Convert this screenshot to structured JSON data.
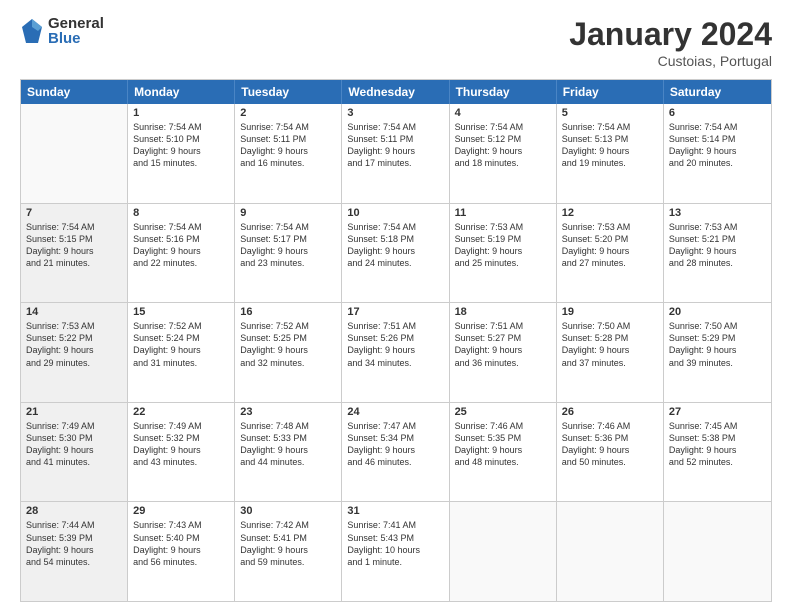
{
  "logo": {
    "general": "General",
    "blue": "Blue"
  },
  "title": "January 2024",
  "subtitle": "Custoias, Portugal",
  "days": [
    "Sunday",
    "Monday",
    "Tuesday",
    "Wednesday",
    "Thursday",
    "Friday",
    "Saturday"
  ],
  "weeks": [
    [
      {
        "day": "",
        "lines": [],
        "empty": true
      },
      {
        "day": "1",
        "lines": [
          "Sunrise: 7:54 AM",
          "Sunset: 5:10 PM",
          "Daylight: 9 hours",
          "and 15 minutes."
        ],
        "empty": false
      },
      {
        "day": "2",
        "lines": [
          "Sunrise: 7:54 AM",
          "Sunset: 5:11 PM",
          "Daylight: 9 hours",
          "and 16 minutes."
        ],
        "empty": false
      },
      {
        "day": "3",
        "lines": [
          "Sunrise: 7:54 AM",
          "Sunset: 5:11 PM",
          "Daylight: 9 hours",
          "and 17 minutes."
        ],
        "empty": false
      },
      {
        "day": "4",
        "lines": [
          "Sunrise: 7:54 AM",
          "Sunset: 5:12 PM",
          "Daylight: 9 hours",
          "and 18 minutes."
        ],
        "empty": false
      },
      {
        "day": "5",
        "lines": [
          "Sunrise: 7:54 AM",
          "Sunset: 5:13 PM",
          "Daylight: 9 hours",
          "and 19 minutes."
        ],
        "empty": false
      },
      {
        "day": "6",
        "lines": [
          "Sunrise: 7:54 AM",
          "Sunset: 5:14 PM",
          "Daylight: 9 hours",
          "and 20 minutes."
        ],
        "empty": false
      }
    ],
    [
      {
        "day": "7",
        "lines": [
          "Sunrise: 7:54 AM",
          "Sunset: 5:15 PM",
          "Daylight: 9 hours",
          "and 21 minutes."
        ],
        "shaded": true
      },
      {
        "day": "8",
        "lines": [
          "Sunrise: 7:54 AM",
          "Sunset: 5:16 PM",
          "Daylight: 9 hours",
          "and 22 minutes."
        ],
        "empty": false
      },
      {
        "day": "9",
        "lines": [
          "Sunrise: 7:54 AM",
          "Sunset: 5:17 PM",
          "Daylight: 9 hours",
          "and 23 minutes."
        ],
        "empty": false
      },
      {
        "day": "10",
        "lines": [
          "Sunrise: 7:54 AM",
          "Sunset: 5:18 PM",
          "Daylight: 9 hours",
          "and 24 minutes."
        ],
        "empty": false
      },
      {
        "day": "11",
        "lines": [
          "Sunrise: 7:53 AM",
          "Sunset: 5:19 PM",
          "Daylight: 9 hours",
          "and 25 minutes."
        ],
        "empty": false
      },
      {
        "day": "12",
        "lines": [
          "Sunrise: 7:53 AM",
          "Sunset: 5:20 PM",
          "Daylight: 9 hours",
          "and 27 minutes."
        ],
        "empty": false
      },
      {
        "day": "13",
        "lines": [
          "Sunrise: 7:53 AM",
          "Sunset: 5:21 PM",
          "Daylight: 9 hours",
          "and 28 minutes."
        ],
        "empty": false
      }
    ],
    [
      {
        "day": "14",
        "lines": [
          "Sunrise: 7:53 AM",
          "Sunset: 5:22 PM",
          "Daylight: 9 hours",
          "and 29 minutes."
        ],
        "shaded": true
      },
      {
        "day": "15",
        "lines": [
          "Sunrise: 7:52 AM",
          "Sunset: 5:24 PM",
          "Daylight: 9 hours",
          "and 31 minutes."
        ],
        "empty": false
      },
      {
        "day": "16",
        "lines": [
          "Sunrise: 7:52 AM",
          "Sunset: 5:25 PM",
          "Daylight: 9 hours",
          "and 32 minutes."
        ],
        "empty": false
      },
      {
        "day": "17",
        "lines": [
          "Sunrise: 7:51 AM",
          "Sunset: 5:26 PM",
          "Daylight: 9 hours",
          "and 34 minutes."
        ],
        "empty": false
      },
      {
        "day": "18",
        "lines": [
          "Sunrise: 7:51 AM",
          "Sunset: 5:27 PM",
          "Daylight: 9 hours",
          "and 36 minutes."
        ],
        "empty": false
      },
      {
        "day": "19",
        "lines": [
          "Sunrise: 7:50 AM",
          "Sunset: 5:28 PM",
          "Daylight: 9 hours",
          "and 37 minutes."
        ],
        "empty": false
      },
      {
        "day": "20",
        "lines": [
          "Sunrise: 7:50 AM",
          "Sunset: 5:29 PM",
          "Daylight: 9 hours",
          "and 39 minutes."
        ],
        "empty": false
      }
    ],
    [
      {
        "day": "21",
        "lines": [
          "Sunrise: 7:49 AM",
          "Sunset: 5:30 PM",
          "Daylight: 9 hours",
          "and 41 minutes."
        ],
        "shaded": true
      },
      {
        "day": "22",
        "lines": [
          "Sunrise: 7:49 AM",
          "Sunset: 5:32 PM",
          "Daylight: 9 hours",
          "and 43 minutes."
        ],
        "empty": false
      },
      {
        "day": "23",
        "lines": [
          "Sunrise: 7:48 AM",
          "Sunset: 5:33 PM",
          "Daylight: 9 hours",
          "and 44 minutes."
        ],
        "empty": false
      },
      {
        "day": "24",
        "lines": [
          "Sunrise: 7:47 AM",
          "Sunset: 5:34 PM",
          "Daylight: 9 hours",
          "and 46 minutes."
        ],
        "empty": false
      },
      {
        "day": "25",
        "lines": [
          "Sunrise: 7:46 AM",
          "Sunset: 5:35 PM",
          "Daylight: 9 hours",
          "and 48 minutes."
        ],
        "empty": false
      },
      {
        "day": "26",
        "lines": [
          "Sunrise: 7:46 AM",
          "Sunset: 5:36 PM",
          "Daylight: 9 hours",
          "and 50 minutes."
        ],
        "empty": false
      },
      {
        "day": "27",
        "lines": [
          "Sunrise: 7:45 AM",
          "Sunset: 5:38 PM",
          "Daylight: 9 hours",
          "and 52 minutes."
        ],
        "empty": false
      }
    ],
    [
      {
        "day": "28",
        "lines": [
          "Sunrise: 7:44 AM",
          "Sunset: 5:39 PM",
          "Daylight: 9 hours",
          "and 54 minutes."
        ],
        "shaded": true
      },
      {
        "day": "29",
        "lines": [
          "Sunrise: 7:43 AM",
          "Sunset: 5:40 PM",
          "Daylight: 9 hours",
          "and 56 minutes."
        ],
        "empty": false
      },
      {
        "day": "30",
        "lines": [
          "Sunrise: 7:42 AM",
          "Sunset: 5:41 PM",
          "Daylight: 9 hours",
          "and 59 minutes."
        ],
        "empty": false
      },
      {
        "day": "31",
        "lines": [
          "Sunrise: 7:41 AM",
          "Sunset: 5:43 PM",
          "Daylight: 10 hours",
          "and 1 minute."
        ],
        "empty": false
      },
      {
        "day": "",
        "lines": [],
        "empty": true
      },
      {
        "day": "",
        "lines": [],
        "empty": true
      },
      {
        "day": "",
        "lines": [],
        "empty": true
      }
    ]
  ]
}
